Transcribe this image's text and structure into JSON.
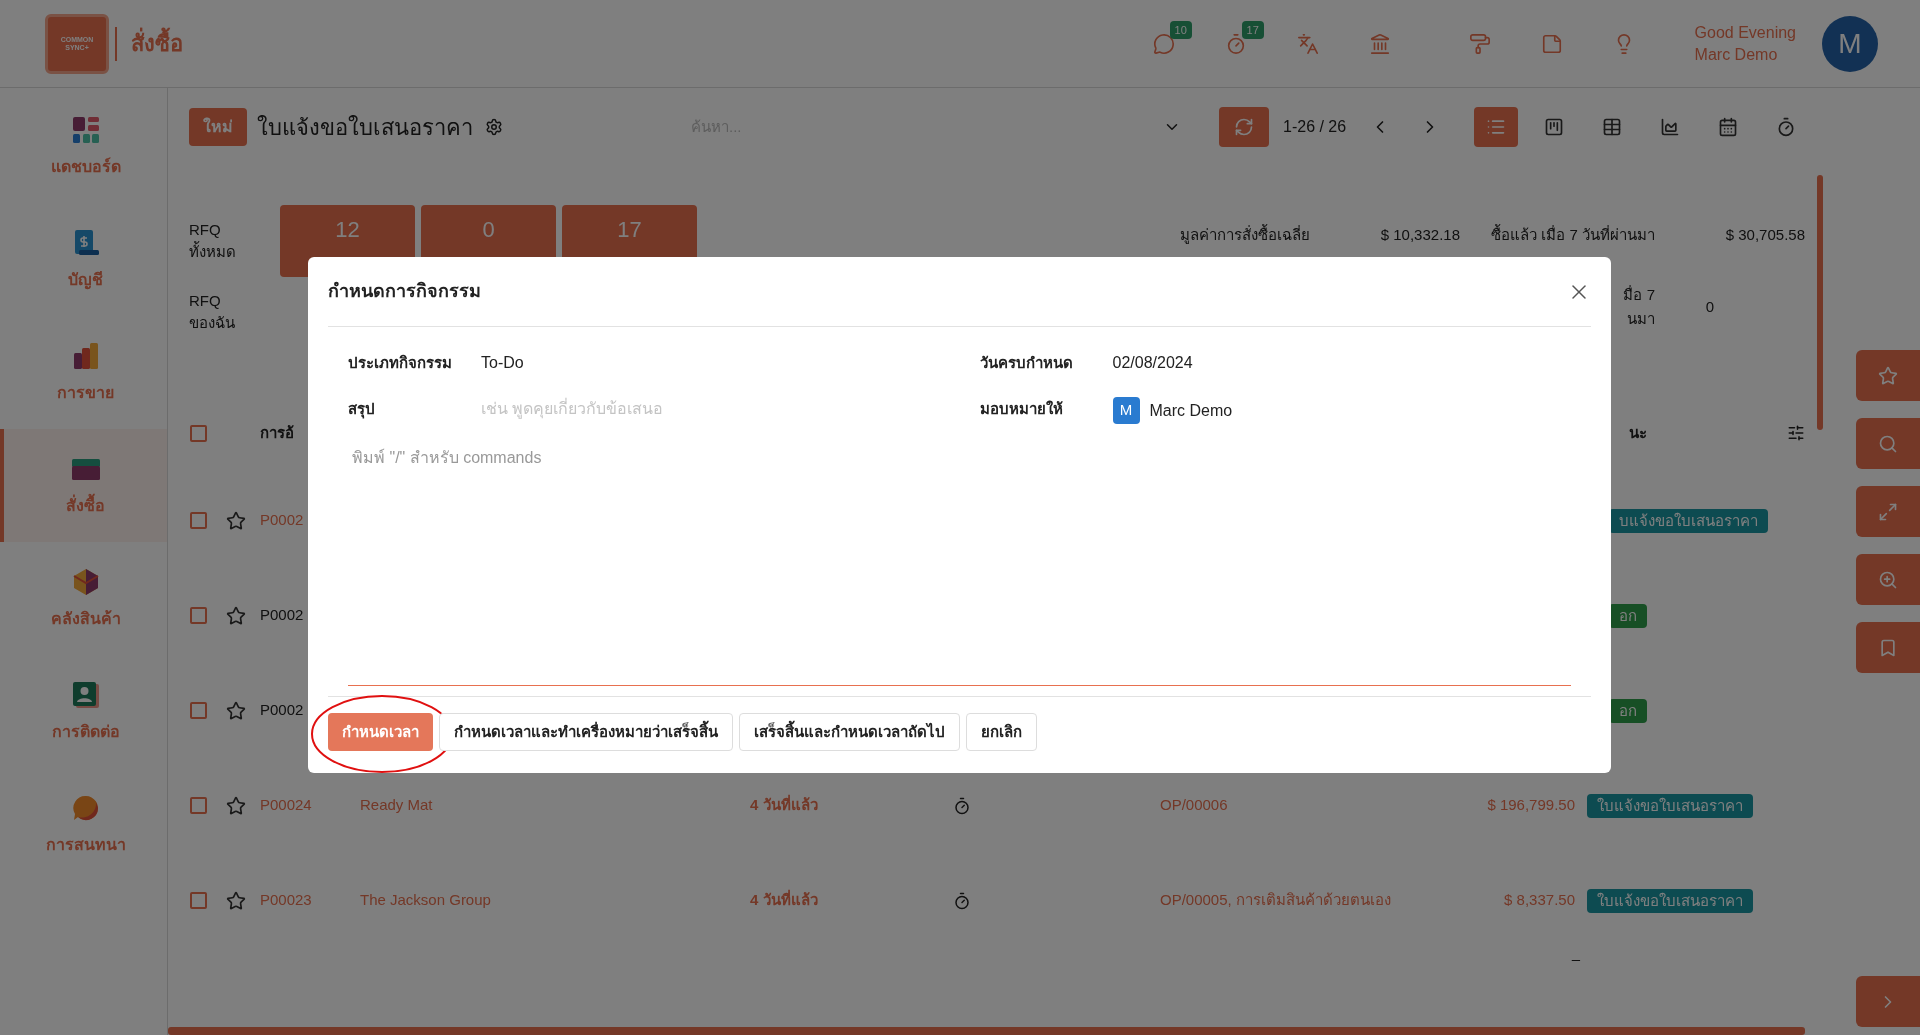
{
  "top_bar": {
    "logo_text": "COMMON SYNC+",
    "app_title": "สั่งซื้อ",
    "icons": [
      {
        "kind": "chat",
        "badge": "10"
      },
      {
        "kind": "timer",
        "badge": "17"
      },
      {
        "kind": "translate"
      },
      {
        "kind": "building"
      },
      {
        "kind": "roller"
      },
      {
        "kind": "note"
      },
      {
        "kind": "bulb"
      }
    ],
    "greeting": "Good Evening",
    "user_name": "Marc Demo",
    "avatar": "M"
  },
  "sidebar": {
    "items": [
      {
        "kind": "dashboard",
        "label": "แดชบอร์ด",
        "selected": false
      },
      {
        "kind": "accounting",
        "label": "บัญชี",
        "selected": false
      },
      {
        "kind": "sales",
        "label": "การขาย",
        "selected": false
      },
      {
        "kind": "purchase",
        "label": "สั่งซื้อ",
        "selected": true
      },
      {
        "kind": "inventory",
        "label": "คลังสินค้า",
        "selected": false
      },
      {
        "kind": "contacts",
        "label": "การติดต่อ",
        "selected": false
      },
      {
        "kind": "discuss",
        "label": "การสนทนา",
        "selected": false
      }
    ]
  },
  "control_panel": {
    "new_button": "ใหม่",
    "title": "ใบแจ้งขอใบเสนอราคา",
    "search_placeholder": "ค้นหา...",
    "pager": "1-26 / 26",
    "views": [
      {
        "kind": "list",
        "selected": true
      },
      {
        "kind": "kanban",
        "selected": false
      },
      {
        "kind": "pivot",
        "selected": false
      },
      {
        "kind": "graph",
        "selected": false
      },
      {
        "kind": "calendar",
        "selected": false
      },
      {
        "kind": "activity",
        "selected": false
      }
    ]
  },
  "summary": {
    "row_labels": [
      "RFQ ทั้งหมด",
      "RFQ ของฉัน"
    ],
    "cards": [
      {
        "value": "12"
      },
      {
        "value": "0"
      },
      {
        "value": "17"
      }
    ],
    "metrics": [
      {
        "label": "มูลค่าการสั่งซื้อเฉลี่ย",
        "value": "$ 10,332.18"
      },
      {
        "label": "ซื้อแล้ว เมื่อ 7 วันที่ผ่านมา",
        "value": "$ 30,705.58"
      },
      {
        "label": "มื่อ 7 นมา",
        "value": "0"
      }
    ]
  },
  "table": {
    "columns": [
      "การอ้",
      "นะ"
    ],
    "select_all_checked": false,
    "rows": [
      {
        "checked": false,
        "starred": false,
        "overdue": true,
        "ref": "P0002",
        "status": {
          "label": "บแจ้งขอใบเสนอราคา",
          "color": "#0d4b51"
        }
      },
      {
        "checked": false,
        "starred": false,
        "overdue": false,
        "ref": "P0002",
        "status": {
          "label": "อก",
          "color": "#174f25"
        }
      },
      {
        "checked": false,
        "starred": false,
        "overdue": false,
        "ref": "P0002",
        "status": {
          "label": "อก",
          "color": "#174f25"
        }
      },
      {
        "checked": false,
        "starred": false,
        "overdue": true,
        "ref": "P00024",
        "vendor": "Ready Mat",
        "date": "4 วันที่แล้ว",
        "origin": "OP/00006",
        "total": "$ 196,799.50",
        "status": {
          "label": "ใบแจ้งขอใบเสนอราคา",
          "color": "#0d4b51"
        }
      },
      {
        "checked": false,
        "starred": false,
        "overdue": true,
        "ref": "P00023",
        "vendor": "The Jackson Group",
        "date": "4 วันที่แล้ว",
        "origin": "OP/00005, การเติมสินค้าด้วยตนเอง",
        "total": "$ 8,337.50",
        "status": {
          "label": "ใบแจ้งขอใบเสนอราคา",
          "color": "#0d4b51"
        }
      }
    ],
    "footer_mark": "–"
  },
  "side_tools": [
    {
      "kind": "star"
    },
    {
      "kind": "search"
    },
    {
      "kind": "expand"
    },
    {
      "kind": "zoom"
    },
    {
      "kind": "bookmark"
    },
    {
      "kind": "next"
    }
  ],
  "dialog": {
    "title": "กำหนดการกิจกรรม",
    "fields": [
      {
        "kind": "text",
        "label": "ประเภทกิจกรรม",
        "value": "To-Do"
      },
      {
        "kind": "text",
        "label": "วันครบกำหนด",
        "value": "02/08/2024"
      },
      {
        "kind": "input",
        "label": "สรุป",
        "placeholder": "เช่น พูดคุยเกี่ยวกับข้อเสนอ"
      },
      {
        "kind": "user",
        "label": "มอบหมายให้",
        "value": "Marc Demo",
        "avatar": "M"
      }
    ],
    "note_placeholder": "พิมพ์ \"/\" สำหรับ commands",
    "buttons": [
      {
        "kind": "primary",
        "label": "กำหนดเวลา"
      },
      {
        "kind": "secondary",
        "label": "กำหนดเวลาและทำเครื่องหมายว่าเสร็จสิ้น"
      },
      {
        "kind": "secondary",
        "label": "เสร็จสิ้นและกำหนดเวลาถัดไป"
      },
      {
        "kind": "secondary",
        "label": "ยกเลิก"
      }
    ]
  }
}
